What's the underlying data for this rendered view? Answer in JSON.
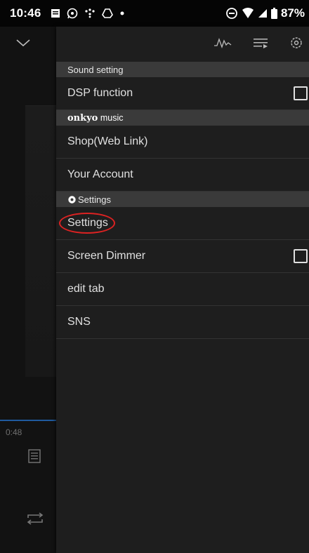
{
  "status_bar": {
    "time": "10:46",
    "battery": "87%",
    "icons": [
      "notification-icon",
      "whatsapp-icon",
      "dots-icon",
      "drive-icon",
      "dot-icon",
      "dnd-icon",
      "wifi-icon",
      "signal-icon",
      "battery-icon"
    ]
  },
  "player": {
    "elapsed": "0:48"
  },
  "toolbar": {
    "icons": [
      "equalizer-wave-icon",
      "queue-icon",
      "settings-gear-icon"
    ]
  },
  "menu": {
    "sound_header": "Sound setting",
    "dsp_label": "DSP function",
    "brand_bold": "onkyo",
    "brand_rest": " music",
    "shop_label": "Shop(Web Link)",
    "account_label": "Your Account",
    "settings_header": "Settings",
    "settings_label": "Settings",
    "dimmer_label": "Screen Dimmer",
    "edit_tab_label": "edit tab",
    "sns_label": "SNS"
  },
  "colors": {
    "drawer_bg": "#1e1e1e",
    "header_bg": "#3a3a3a",
    "annotation_circle": "#d22222",
    "progress": "#1f5a9e"
  }
}
